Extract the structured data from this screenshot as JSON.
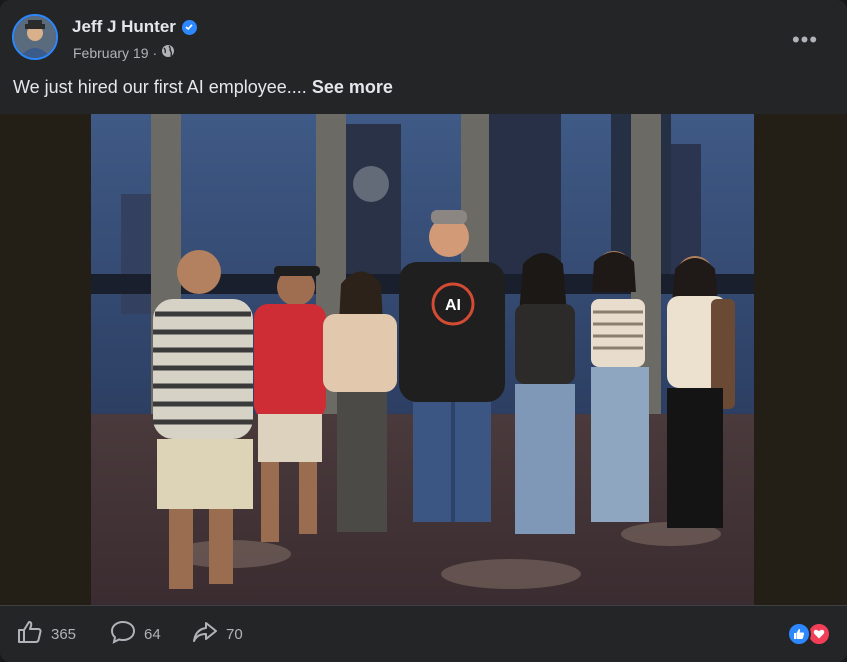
{
  "post": {
    "author": "Jeff J Hunter",
    "date": "February 19",
    "separator": "·",
    "more_icon": "ellipsis-icon",
    "text": "We just hired our first AI employee....",
    "see_more": "See more"
  },
  "photo": {
    "shirt_logo_text": "AI",
    "description_icon": "group-photo"
  },
  "actions": {
    "likes": "365",
    "comments": "64",
    "shares": "70"
  },
  "colors": {
    "background": "#242526",
    "text": "#e4e6eb",
    "muted": "#b0b3b8",
    "accent": "#2d88ff",
    "love": "#f33e58"
  }
}
